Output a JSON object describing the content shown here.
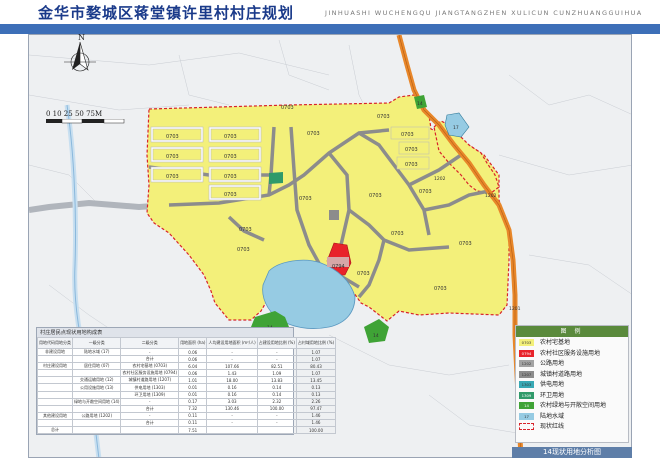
{
  "title": "金华市婺城区蒋堂镇许里村村庄规划",
  "subtitle": "JINHUASHI WUCHENGQU JIANGTANGZHEN XULICUN CUNZHUANGGUIHUA",
  "north_label": "N",
  "scale_text": "0 10 25   50   75M",
  "map_labels": {
    "residential_code": "0703",
    "service_code": "0794",
    "road_code": "1202",
    "highway_code": "1201",
    "park_code": "14",
    "water_code": "17"
  },
  "table": {
    "caption": "村庄居民点现状用地构成表",
    "headers": [
      "用地代码用地分类",
      "一级分类",
      "二级分类",
      "用地面积 (ha)",
      "人均建设用地面积 (m²/人)",
      "占建设用地比例 (%)",
      "占村域用地比例 (%)"
    ],
    "rows": [
      [
        "非建设用地",
        "陆地水域 (17)",
        "-",
        "0.06",
        "-",
        "-",
        "1.07"
      ],
      [
        "",
        "",
        "合计",
        "0.06",
        "-",
        "-",
        "1.07"
      ],
      [
        "村庄建设用地",
        "居住用地 (07)",
        "农村宅基地 (0703)",
        "6.04",
        "107.66",
        "82.51",
        "80.43"
      ],
      [
        "",
        "",
        "农村社区服务设施用地 (0794)",
        "0.06",
        "1.43",
        "1.09",
        "1.07"
      ],
      [
        "",
        "交通运输用地 (12)",
        "城镇村道路用地 (1207)",
        "1.01",
        "18.00",
        "13.83",
        "13.45"
      ],
      [
        "",
        "公用设施用地 (13)",
        "供电用地 (1303)",
        "0.01",
        "0.16",
        "0.14",
        "0.13"
      ],
      [
        "",
        "",
        "环卫用地 (1309)",
        "0.01",
        "0.16",
        "0.14",
        "0.13"
      ],
      [
        "",
        "绿地与开敞空间用地 (14)",
        "-",
        "0.17",
        "3.03",
        "2.32",
        "2.26"
      ],
      [
        "",
        "",
        "合计",
        "7.32",
        "130.46",
        "100.00",
        "97.47"
      ],
      [
        "其他建设用地",
        "公路用地 (1202)",
        "-",
        "0.11",
        "-",
        "-",
        "1.46"
      ],
      [
        "",
        "",
        "合计",
        "0.11",
        "-",
        "-",
        "1.46"
      ],
      [
        "总计",
        "",
        "",
        "7.51",
        "",
        "",
        "100.00"
      ]
    ]
  },
  "legend": {
    "header": "图 例",
    "items": [
      {
        "code": "0703",
        "label": "农村宅基地",
        "color": "#f3f07a"
      },
      {
        "code": "0794",
        "label": "农村社区服务设施用地",
        "color": "#e8232a"
      },
      {
        "code": "1202",
        "label": "公路用地",
        "color": "#a3a3a3"
      },
      {
        "code": "1207",
        "label": "城镇村道路用地",
        "color": "#8c8c8c"
      },
      {
        "code": "1303",
        "label": "供电用地",
        "color": "#38a8b4"
      },
      {
        "code": "1309",
        "label": "环卫用地",
        "color": "#2f9a6a"
      },
      {
        "code": "14",
        "label": "农村绿地与开敞空间用地",
        "color": "#3fa336"
      },
      {
        "code": "17",
        "label": "陆地水域",
        "color": "#96cbe3"
      },
      {
        "code": "",
        "label": "现状红线",
        "color": "#d8232a"
      }
    ]
  },
  "footer": "14现状用地分析图",
  "colors": {
    "residential": "#f3f07a",
    "road": "#8c8c8c",
    "highway": "#e8872a",
    "water": "#96cbe3",
    "green": "#3fa336",
    "redline": "#d8232a",
    "header_band": "#3d6fb8"
  }
}
